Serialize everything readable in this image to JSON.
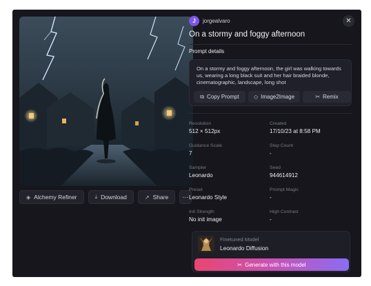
{
  "user": {
    "avatar_initial": "J",
    "name": "jorgealvaro"
  },
  "image": {
    "title": "On a stormy and foggy afternoon"
  },
  "actions": {
    "alchemy_refiner": "Alchemy Refiner",
    "download": "Download",
    "share": "Share",
    "more": "⋯"
  },
  "prompt": {
    "section_label": "Prompt details",
    "text": "On a stormy and foggy afternoon, the girl was walking towards us, wearing a long black suit and her hair braided blonde, cinematographic, landscape, long shot",
    "copy_label": "Copy Prompt",
    "image2image_label": "Image2Image",
    "remix_label": "Remix"
  },
  "details": {
    "resolution": {
      "label": "Resolution",
      "value": "512 × 512px"
    },
    "created": {
      "label": "Created",
      "value": "17/10/23 at 8:58 PM"
    },
    "guidance": {
      "label": "Guidance Scale",
      "value": "7"
    },
    "steps": {
      "label": "Step Count",
      "value": "-"
    },
    "sampler": {
      "label": "Sampler",
      "value": "Leonardo"
    },
    "seed": {
      "label": "Seed",
      "value": "944614912"
    },
    "preset": {
      "label": "Preset",
      "value": "Leonardo Style"
    },
    "prompt_magic": {
      "label": "Prompt Magic",
      "value": "-"
    },
    "init_strength": {
      "label": "Init Strength",
      "value": "No init image"
    },
    "high_contrast": {
      "label": "High Contrast",
      "value": "-"
    }
  },
  "model": {
    "label": "Finetuned Model",
    "name": "Leonardo Diffusion",
    "generate_label": "Generate with this model"
  },
  "icons": {
    "close": "close-icon",
    "alchemy": "alchemy-diamond-icon",
    "download": "download-icon",
    "share": "share-icon",
    "copy": "copy-icon",
    "image2image": "layers-icon",
    "remix": "remix-icon",
    "generate": "sparkle-icon"
  },
  "colors": {
    "background": "#16161c",
    "avatar": "#7c56e8",
    "gradient_start": "#e9466f",
    "gradient_end": "#8a6df3"
  }
}
